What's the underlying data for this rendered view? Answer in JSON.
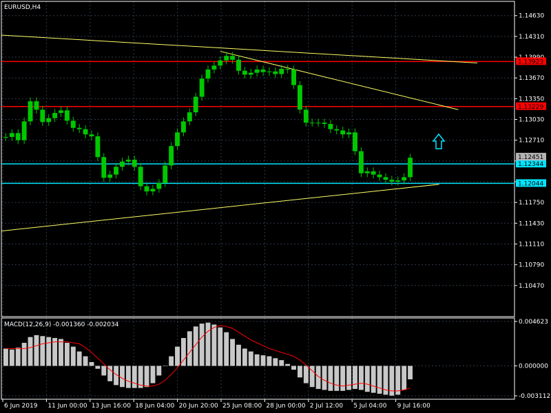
{
  "window": {
    "symbol_label": "EURUSD,H4",
    "macd_label": "MACD(12,26,9) -0.001360 -0.002034"
  },
  "colors": {
    "background": "#000000",
    "frame": "#ffffff",
    "grid": "#2e3a4a",
    "candle": "#00c800",
    "resistance": "#ff0000",
    "support": "#00e5ff",
    "trendline": "#ffff66",
    "macd_hist": "#c8c8c8",
    "macd_signal": "#ff0000",
    "price_tag": "#b4b4b4"
  },
  "chart_data": [
    {
      "type": "line",
      "title": "EURUSD,H4",
      "ylim": [
        1.0999,
        1.1485
      ],
      "y_ticks": [
        "1.14630",
        "1.14310",
        "1.13990",
        "1.13670",
        "1.13350",
        "1.13030",
        "1.12710",
        "1.12390",
        "1.12070",
        "1.11750",
        "1.11430",
        "1.11110",
        "1.10790",
        "1.10470"
      ],
      "x_ticks": [
        "6 Jun 2019",
        "11 Jun 00:00",
        "13 Jun 16:00",
        "18 Jun 04:00",
        "20 Jun 20:00",
        "25 Jun 08:00",
        "28 Jun 00:00",
        "2 Jul 12:00",
        "5 Jul 04:00",
        "9 Jul 16:00"
      ],
      "x_range": [
        "6 Jun 2019",
        "9 Jul 16:00"
      ],
      "series": [
        {
          "values": [
            1.1276,
            1.1282,
            1.1271,
            1.13,
            1.1331,
            1.1318,
            1.1299,
            1.1305,
            1.1313,
            1.1317,
            1.1301,
            1.129,
            1.1288,
            1.128,
            1.1277,
            1.1245,
            1.1213,
            1.1218,
            1.123,
            1.1238,
            1.1241,
            1.123,
            1.12,
            1.1192,
            1.1196,
            1.1205,
            1.1232,
            1.1262,
            1.1283,
            1.13,
            1.1314,
            1.1338,
            1.1366,
            1.138,
            1.1386,
            1.1394,
            1.1401,
            1.1395,
            1.1378,
            1.1372,
            1.1375,
            1.138,
            1.1376,
            1.1377,
            1.1373,
            1.1381,
            1.138,
            1.1356,
            1.1318,
            1.1298,
            1.1298,
            1.1298,
            1.1296,
            1.1288,
            1.1286,
            1.128,
            1.1283,
            1.1254,
            1.122,
            1.1223,
            1.1218,
            1.1214,
            1.121,
            1.1207,
            1.1209,
            1.1214,
            1.1244
          ]
        }
      ],
      "horizontal_levels": [
        {
          "price": "1.13923",
          "kind": "resistance"
        },
        {
          "price": "1.13229",
          "kind": "resistance"
        },
        {
          "price": "1.12344",
          "kind": "support"
        },
        {
          "price": "1.12044",
          "kind": "support"
        }
      ],
      "current_price": "1.12451",
      "trendlines": [
        {
          "from": [
            0,
            1.1433
          ],
          "to": [
            100,
            1.139
          ]
        },
        {
          "from": [
            0,
            1.1131
          ],
          "to": [
            92,
            1.1203
          ]
        },
        {
          "from": [
            46,
            1.1408
          ],
          "to": [
            96,
            1.1318
          ]
        }
      ],
      "annotations": [
        "up-arrow"
      ],
      "grid": true
    },
    {
      "type": "bar",
      "title": "MACD(12,26,9) -0.001360 -0.002034",
      "ylim": [
        -0.003112,
        0.004623
      ],
      "y_ticks": [
        "0.004623",
        "0.000000",
        "-0.003112"
      ],
      "histogram": [
        0.0018,
        0.0017,
        0.0019,
        0.0024,
        0.003,
        0.0032,
        0.0031,
        0.003,
        0.0029,
        0.0028,
        0.0024,
        0.002,
        0.0015,
        0.001,
        0.0004,
        -0.0003,
        -0.001,
        -0.0016,
        -0.002,
        -0.0022,
        -0.0023,
        -0.0023,
        -0.0023,
        -0.0022,
        -0.0018,
        -0.001,
        0.0,
        0.001,
        0.002,
        0.0029,
        0.0036,
        0.0041,
        0.0044,
        0.0045,
        0.0043,
        0.004,
        0.0035,
        0.0028,
        0.0022,
        0.0018,
        0.0015,
        0.0012,
        0.0011,
        0.001,
        0.0008,
        0.0006,
        0.0002,
        -0.0004,
        -0.0012,
        -0.0018,
        -0.0022,
        -0.0024,
        -0.0025,
        -0.0026,
        -0.0026,
        -0.0026,
        -0.0025,
        -0.0024,
        -0.0025,
        -0.0027,
        -0.0028,
        -0.0029,
        -0.003,
        -0.0031,
        -0.003,
        -0.0025,
        -0.0014
      ],
      "signal": [
        0.0018,
        0.0018,
        0.0018,
        0.0018,
        0.0019,
        0.0021,
        0.0023,
        0.0024,
        0.0025,
        0.0025,
        0.0025,
        0.0024,
        0.0023,
        0.0019,
        0.0014,
        0.0008,
        0.0002,
        -0.0004,
        -0.0009,
        -0.0013,
        -0.0016,
        -0.0018,
        -0.002,
        -0.0021,
        -0.0021,
        -0.0019,
        -0.0015,
        -0.0009,
        -0.0002,
        0.0006,
        0.0014,
        0.0022,
        0.003,
        0.0036,
        0.004,
        0.0042,
        0.0041,
        0.0039,
        0.0035,
        0.0031,
        0.0027,
        0.0024,
        0.0021,
        0.0018,
        0.0016,
        0.0014,
        0.0012,
        0.001,
        0.0006,
        0.0001,
        -0.0005,
        -0.0011,
        -0.0015,
        -0.0018,
        -0.002,
        -0.0021,
        -0.002,
        -0.0019,
        -0.0018,
        -0.0019,
        -0.0021,
        -0.0023,
        -0.0025,
        -0.0026,
        -0.0026,
        -0.0025,
        -0.0023
      ]
    }
  ]
}
